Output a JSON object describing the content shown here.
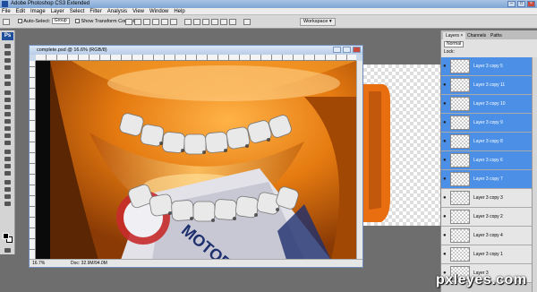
{
  "app": {
    "title": "Adobe Photoshop CS3 Extended"
  },
  "menubar": {
    "items": [
      "File",
      "Edit",
      "Image",
      "Layer",
      "Select",
      "Filter",
      "Analysis",
      "View",
      "Window",
      "Help"
    ]
  },
  "optionsbar": {
    "auto_select_label": "Auto-Select:",
    "auto_select_value": "Group",
    "show_transform_label": "Show Transform Controls",
    "workspace_label": "Workspace ▾"
  },
  "document": {
    "title": "complete.psd @ 16.6% (RGB/8)",
    "zoom": "16.7%",
    "doc_info": "Doc: 32.9M/94.0M"
  },
  "layers_panel": {
    "tabs": [
      "Layers ×",
      "Channels",
      "Paths"
    ],
    "blend_mode": "Normal",
    "lock_label": "Lock:",
    "layers": [
      {
        "name": "Layer 3 copy 5",
        "selected": true
      },
      {
        "name": "Layer 3 copy 11",
        "selected": true
      },
      {
        "name": "Layer 3 copy 10",
        "selected": true
      },
      {
        "name": "Layer 3 copy 9",
        "selected": true
      },
      {
        "name": "Layer 3 copy 8",
        "selected": true
      },
      {
        "name": "Layer 3 copy 6",
        "selected": true
      },
      {
        "name": "Layer 3 copy 7",
        "selected": true
      },
      {
        "name": "Layer 3 copy 3",
        "selected": false
      },
      {
        "name": "Layer 3 copy 2",
        "selected": false
      },
      {
        "name": "Layer 3 copy 4",
        "selected": false
      },
      {
        "name": "Layer 3 copy 1",
        "selected": false
      },
      {
        "name": "Layer 3",
        "selected": false
      }
    ]
  },
  "colors": {
    "selected_layer": "#4b8fe6",
    "canvas_orange": "#e07610",
    "titlebar": "#7fa6d4"
  },
  "watermark": "pxleyes.com"
}
